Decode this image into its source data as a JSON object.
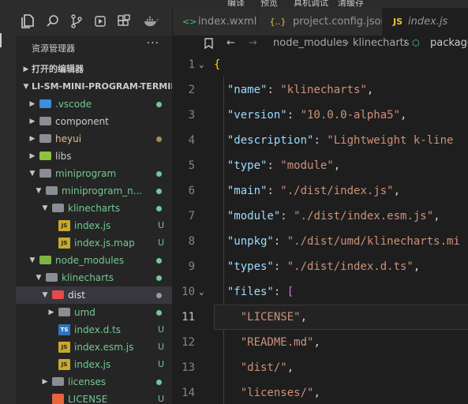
{
  "top_strip": {
    "items": [
      "编译",
      "预览",
      "真机调试",
      "清缓存"
    ]
  },
  "activity_bar": {
    "icons": [
      "files-icon",
      "search-icon",
      "source-control-icon",
      "debug-icon",
      "extensions-icon",
      "docker-icon"
    ]
  },
  "sidebar": {
    "title": "资源管理器",
    "more": "···",
    "rows": [
      {
        "label": "打开的编辑器",
        "indent": 0,
        "arrow": "▶",
        "icon": "none",
        "color": "#cccccc",
        "badge": "",
        "dot": "",
        "bold": true
      },
      {
        "label": "LI-SM-MINI-PROGRAM-TERMIN...",
        "indent": 0,
        "arrow": "▼",
        "icon": "none",
        "color": "#cccccc",
        "badge": "",
        "dot": "",
        "bold": true
      },
      {
        "label": ".vscode",
        "indent": 1,
        "arrow": "▶",
        "icon": "folder-vscode",
        "color": "#73c991",
        "badge": "",
        "dot": "#73c991"
      },
      {
        "label": "component",
        "indent": 1,
        "arrow": "▶",
        "icon": "folder",
        "color": "#cccccc",
        "badge": "",
        "dot": ""
      },
      {
        "label": "heyui",
        "indent": 1,
        "arrow": "▶",
        "icon": "folder",
        "color": "#e2c08d",
        "badge": "",
        "dot": "#a88b5a"
      },
      {
        "label": "libs",
        "indent": 1,
        "arrow": "▶",
        "icon": "folder-libs",
        "color": "#cccccc",
        "badge": "",
        "dot": ""
      },
      {
        "label": "miniprogram",
        "indent": 1,
        "arrow": "▼",
        "icon": "folder",
        "color": "#73c991",
        "badge": "",
        "dot": "#73c991"
      },
      {
        "label": "miniprogram_n...",
        "indent": 2,
        "arrow": "▼",
        "icon": "folder",
        "color": "#73c991",
        "badge": "",
        "dot": "#73c991"
      },
      {
        "label": "klinecharts",
        "indent": 3,
        "arrow": "▼",
        "icon": "folder",
        "color": "#73c991",
        "badge": "",
        "dot": "#73c991"
      },
      {
        "label": "index.js",
        "indent": 4,
        "arrow": "",
        "icon": "js",
        "color": "#73c991",
        "badge": "U",
        "dot": ""
      },
      {
        "label": "index.js.map",
        "indent": 4,
        "arrow": "",
        "icon": "js",
        "color": "#73c991",
        "badge": "U",
        "dot": ""
      },
      {
        "label": "node_modules",
        "indent": 1,
        "arrow": "▼",
        "icon": "folder-node",
        "color": "#73c991",
        "badge": "",
        "dot": "#73c991"
      },
      {
        "label": "klinecharts",
        "indent": 2,
        "arrow": "▼",
        "icon": "folder",
        "color": "#73c991",
        "badge": "",
        "dot": "#73c991"
      },
      {
        "label": "dist",
        "indent": 3,
        "arrow": "▼",
        "icon": "folder-dist",
        "color": "#e0e0e0",
        "badge": "",
        "dot": "#999999",
        "selected": true
      },
      {
        "label": "umd",
        "indent": 4,
        "arrow": "▶",
        "icon": "folder",
        "color": "#73c991",
        "badge": "",
        "dot": "#73c991"
      },
      {
        "label": "index.d.ts",
        "indent": 4,
        "arrow": "",
        "icon": "ts",
        "color": "#73c991",
        "badge": "U",
        "dot": ""
      },
      {
        "label": "index.esm.js",
        "indent": 4,
        "arrow": "",
        "icon": "js",
        "color": "#73c991",
        "badge": "U",
        "dot": ""
      },
      {
        "label": "index.js",
        "indent": 4,
        "arrow": "",
        "icon": "js",
        "color": "#73c991",
        "badge": "U",
        "dot": ""
      },
      {
        "label": "licenses",
        "indent": 3,
        "arrow": "▶",
        "icon": "folder",
        "color": "#73c991",
        "badge": "",
        "dot": "#73c991"
      },
      {
        "label": "LICENSE",
        "indent": 3,
        "arrow": "",
        "icon": "license",
        "color": "#73c991",
        "badge": "U",
        "dot": ""
      }
    ]
  },
  "tabs": [
    {
      "icon": "<>",
      "label": "index.wxml",
      "icon_color": "#4ec96f",
      "italic": false
    },
    {
      "icon": "{..}",
      "label": "project.config.json",
      "icon_color": "#e6c244",
      "italic": false
    },
    {
      "icon": "JS",
      "label": "index.js",
      "icon_color": "#e6c244",
      "italic": true
    }
  ],
  "breadcrumbs": [
    "node_modules",
    "klinecharts",
    "package"
  ],
  "editor": {
    "lines": [
      {
        "n": "1",
        "fold": "⌄",
        "tokens": [
          [
            "b2",
            "{"
          ]
        ]
      },
      {
        "n": "2",
        "fold": "",
        "tokens": [
          [
            "k",
            "  \"name\""
          ],
          [
            "p",
            ": "
          ],
          [
            "s",
            "\"klinecharts\""
          ],
          [
            "p",
            ","
          ]
        ]
      },
      {
        "n": "3",
        "fold": "",
        "tokens": [
          [
            "k",
            "  \"version\""
          ],
          [
            "p",
            ": "
          ],
          [
            "s",
            "\"10.0.0-alpha5\""
          ],
          [
            "p",
            ","
          ]
        ]
      },
      {
        "n": "4",
        "fold": "",
        "tokens": [
          [
            "k",
            "  \"description\""
          ],
          [
            "p",
            ": "
          ],
          [
            "s",
            "\"Lightweight k-line"
          ]
        ]
      },
      {
        "n": "5",
        "fold": "",
        "tokens": [
          [
            "k",
            "  \"type\""
          ],
          [
            "p",
            ": "
          ],
          [
            "s",
            "\"module\""
          ],
          [
            "p",
            ","
          ]
        ]
      },
      {
        "n": "6",
        "fold": "",
        "tokens": [
          [
            "k",
            "  \"main\""
          ],
          [
            "p",
            ": "
          ],
          [
            "s",
            "\"./dist/index.js\""
          ],
          [
            "p",
            ","
          ]
        ]
      },
      {
        "n": "7",
        "fold": "",
        "tokens": [
          [
            "k",
            "  \"module\""
          ],
          [
            "p",
            ": "
          ],
          [
            "s",
            "\"./dist/index.esm.js\""
          ],
          [
            "p",
            ","
          ]
        ]
      },
      {
        "n": "8",
        "fold": "",
        "tokens": [
          [
            "k",
            "  \"unpkg\""
          ],
          [
            "p",
            ": "
          ],
          [
            "s",
            "\"./dist/umd/klinecharts.mi"
          ]
        ]
      },
      {
        "n": "9",
        "fold": "",
        "tokens": [
          [
            "k",
            "  \"types\""
          ],
          [
            "p",
            ": "
          ],
          [
            "s",
            "\"./dist/index.d.ts\""
          ],
          [
            "p",
            ","
          ]
        ]
      },
      {
        "n": "10",
        "fold": "⌄",
        "tokens": [
          [
            "k",
            "  \"files\""
          ],
          [
            "p",
            ": "
          ],
          [
            "b",
            "["
          ]
        ]
      },
      {
        "n": "11",
        "fold": "",
        "tokens": [
          [
            "s",
            "    \"LICENSE\""
          ],
          [
            "p",
            ","
          ]
        ],
        "current": true
      },
      {
        "n": "12",
        "fold": "",
        "tokens": [
          [
            "s",
            "    \"README.md\""
          ],
          [
            "p",
            ","
          ]
        ]
      },
      {
        "n": "13",
        "fold": "",
        "tokens": [
          [
            "s",
            "    \"dist/\""
          ],
          [
            "p",
            ","
          ]
        ]
      },
      {
        "n": "14",
        "fold": "",
        "tokens": [
          [
            "s",
            "    \"licenses/\""
          ],
          [
            "p",
            ","
          ]
        ]
      }
    ]
  }
}
